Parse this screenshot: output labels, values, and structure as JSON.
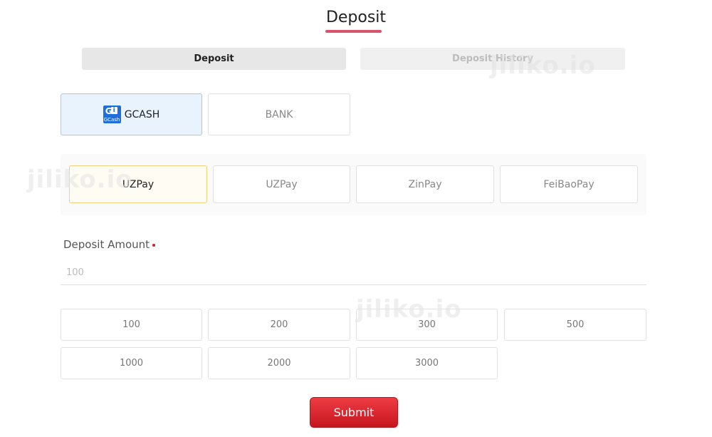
{
  "header": {
    "title": "Deposit"
  },
  "tabs": [
    {
      "label": "Deposit",
      "active": true
    },
    {
      "label": "Deposit History",
      "active": false
    }
  ],
  "methods": [
    {
      "label": "GCASH",
      "icon": "gcash-logo-icon",
      "selected": true,
      "logo_text": "G",
      "logo_sub": "GCash"
    },
    {
      "label": "BANK",
      "selected": false
    }
  ],
  "providers": [
    {
      "label": "UZPay",
      "selected": true
    },
    {
      "label": "UZPay",
      "selected": false
    },
    {
      "label": "ZinPay",
      "selected": false
    },
    {
      "label": "FeiBaoPay",
      "selected": false
    }
  ],
  "deposit": {
    "label": "Deposit Amount",
    "placeholder": "100",
    "value": ""
  },
  "quick_amounts": [
    "100",
    "200",
    "300",
    "500",
    "1000",
    "2000",
    "3000"
  ],
  "submit_label": "Submit",
  "watermark": "jiliko.io",
  "colors": {
    "accent_underline": "#d9546a",
    "submit_red": "#e0242c",
    "selected_method_bg": "#e8f3fd",
    "selected_provider_border": "#f0d27a",
    "required_dot": "#cc2233",
    "gcash_blue": "#1e6fdc"
  }
}
